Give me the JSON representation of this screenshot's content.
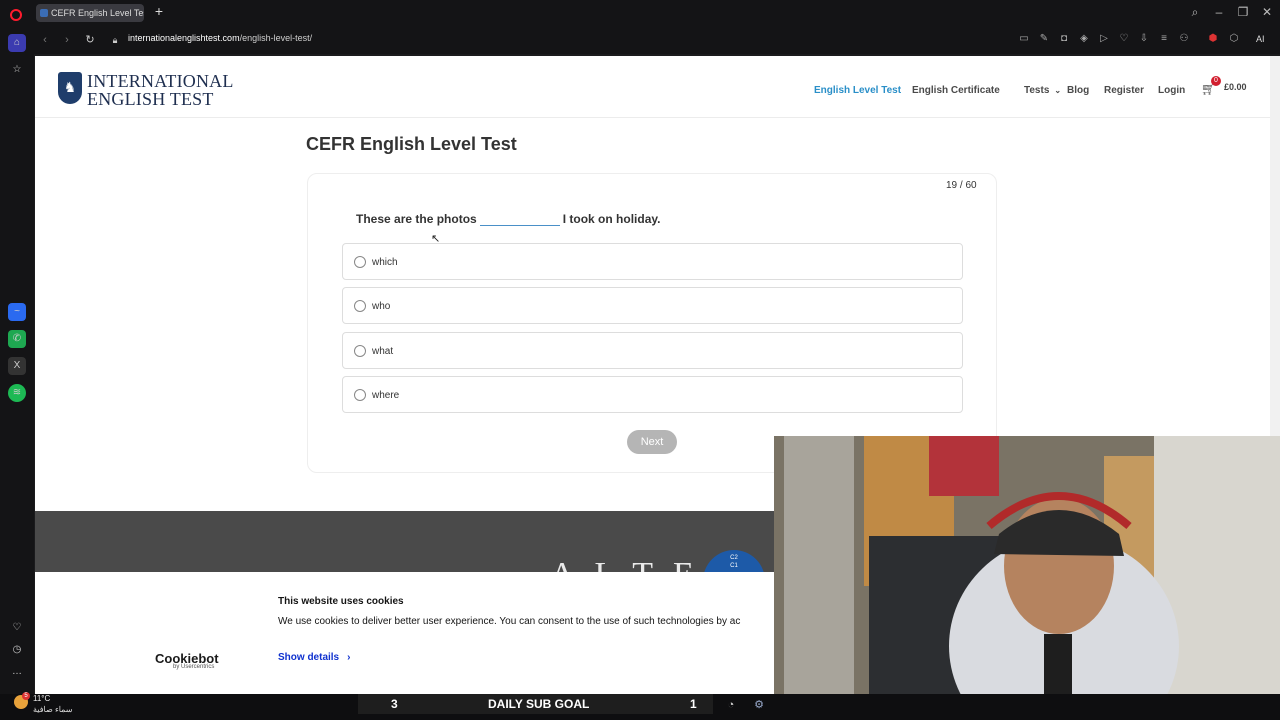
{
  "browser": {
    "tab_title": "CEFR English Level Test - I",
    "url_host": "internationalenglishtest.com",
    "url_path": "/english-level-test/",
    "ai_label": "AI"
  },
  "site": {
    "logo_line1": "INTERNATIONAL",
    "logo_line2": "ENGLISH TEST",
    "nav": [
      "English Level Test",
      "English Certificate",
      "Tests",
      "Blog",
      "Register",
      "Login"
    ],
    "cart_count": "0",
    "cart_total": "£0.00",
    "active_color": "#2a8fc8"
  },
  "quiz": {
    "page_title": "CEFR English Level Test",
    "counter": "19 / 60",
    "question_before": "These are the photos",
    "question_after": "I took on holiday.",
    "options": [
      "which",
      "who",
      "what",
      "where"
    ],
    "next_label": "Next"
  },
  "footer": {
    "alte": "ALTE",
    "disc_line1": "C2",
    "disc_line2": "C1"
  },
  "cookie": {
    "title": "This website uses cookies",
    "text": "We use cookies to deliver better user experience. You can consent to the use of such technologies by ac",
    "brand": "Cookiebot",
    "brand_by": "by Usercentrics",
    "show_details": "Show details"
  },
  "taskbar": {
    "temperature": "11°C",
    "weather": "سماء صافية",
    "goal_left": "3",
    "goal_title": "DAILY SUB GOAL",
    "goal_right": "1",
    "badge": "5"
  }
}
